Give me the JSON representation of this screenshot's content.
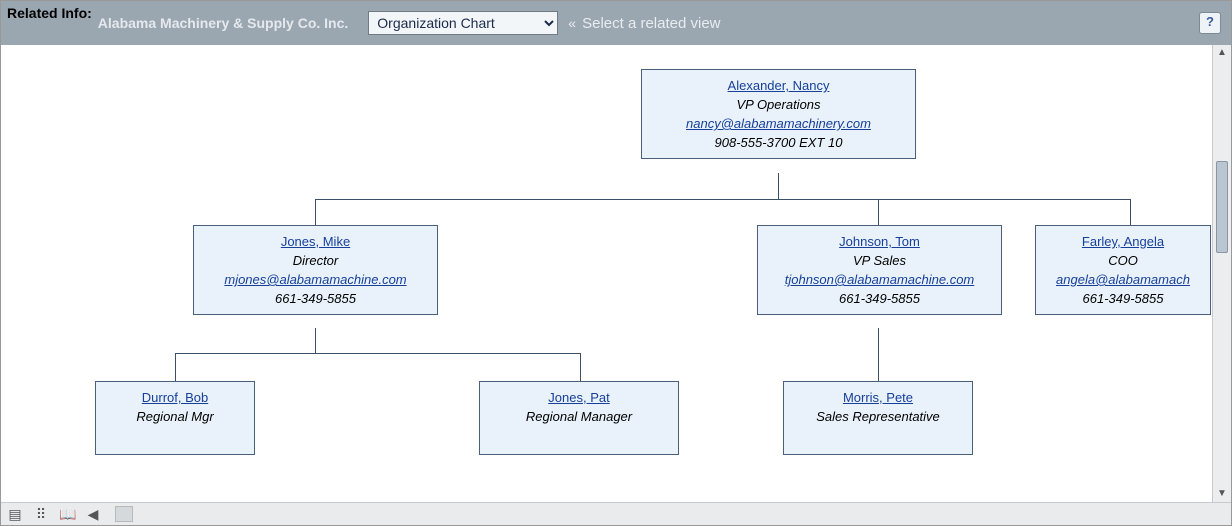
{
  "header": {
    "label": "Related Info:",
    "company": "Alabama Machinery & Supply Co. Inc.",
    "view_select": "Organization Chart",
    "arrows": "«",
    "hint": "Select a related view",
    "help": "?"
  },
  "chart_data": {
    "root": {
      "name": "Alexander, Nancy",
      "title": "VP Operations",
      "email": "nancy@alabamamachinery.com",
      "phone": "908-555-3700 EXT 10",
      "children": [
        {
          "name": "Jones, Mike",
          "title": "Director",
          "email": "mjones@alabamamachine.com",
          "phone": "661-349-5855",
          "children": [
            {
              "name": "Durrof, Bob",
              "title": "Regional Mgr"
            },
            {
              "name": "Jones, Pat",
              "title": "Regional Manager"
            }
          ]
        },
        {
          "name": "Johnson, Tom",
          "title": "VP Sales",
          "email": "tjohnson@alabamamachine.com",
          "phone": "661-349-5855",
          "children": [
            {
              "name": "Morris, Pete",
              "title": "Sales Representative"
            }
          ]
        },
        {
          "name": "Farley, Angela",
          "title": "COO",
          "email": "angela@alabamamach",
          "phone": "661-349-5855"
        }
      ]
    }
  }
}
